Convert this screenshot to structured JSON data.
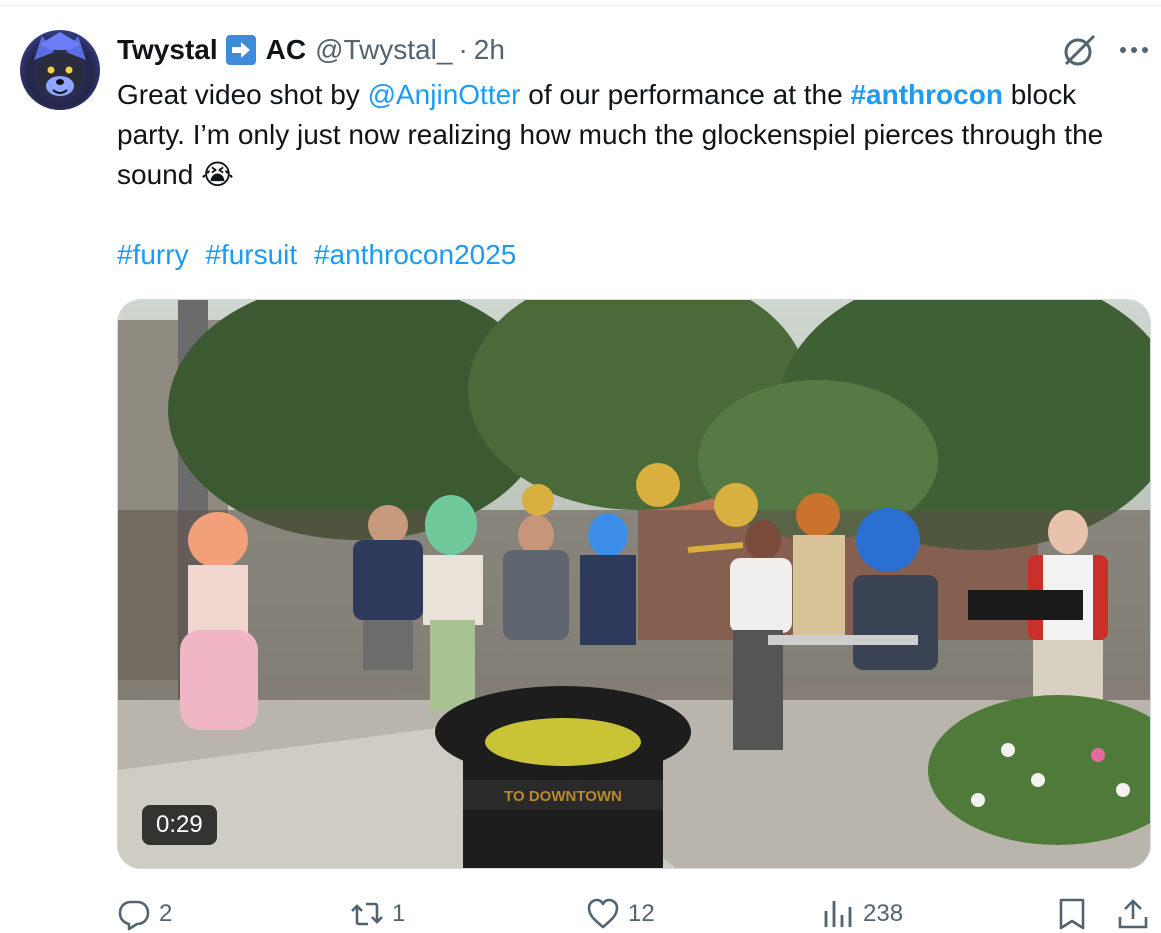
{
  "author": {
    "name": "Twystal",
    "name_suffix": "AC",
    "handle": "@Twystal_",
    "separator": "·",
    "time": "2h"
  },
  "tweet": {
    "text_part1": "Great video shot by ",
    "mention": "@AnjinOtter",
    "text_part2": " of our performance at the ",
    "hashtag_inline": "#anthrocon",
    "text_part3": " block party. I’m only just now realizing how much the glockenspiel pierces through the sound ",
    "emoji": "😭",
    "hashtags": [
      "#furry",
      "#fursuit",
      "#anthrocon2025"
    ]
  },
  "media": {
    "duration": "0:29",
    "sign_text": "TO DOWNTOWN"
  },
  "actions": {
    "replies": "2",
    "reposts": "1",
    "likes": "12",
    "views": "238"
  },
  "icons": {
    "badge": "arrow-right-icon",
    "grok": "grok-icon",
    "more": "more-icon",
    "reply": "reply-icon",
    "repost": "repost-icon",
    "like": "heart-icon",
    "views": "views-icon",
    "bookmark": "bookmark-icon",
    "share": "share-icon"
  },
  "colors": {
    "link": "#1d9bf0",
    "text": "#0f1419",
    "secondary": "#536471",
    "badge": "#3d8bd9"
  }
}
